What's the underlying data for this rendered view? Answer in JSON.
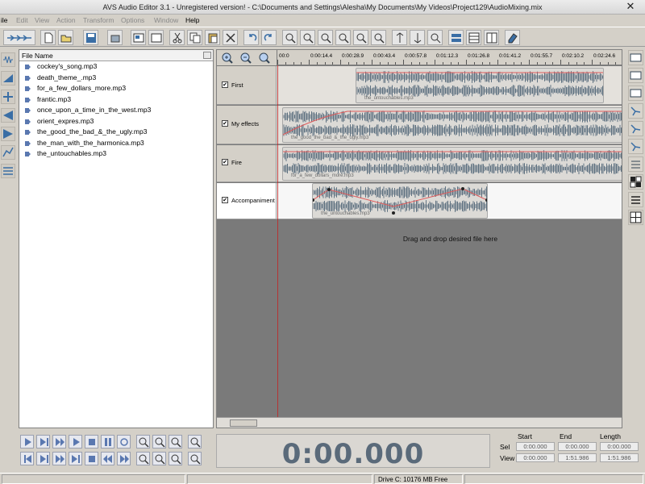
{
  "window": {
    "title": "AVS Audio Editor 3.1 - Unregistered version! - C:\\Documents and Settings\\Alesha\\My Documents\\My Videos\\Project129\\AudioMixing.mix",
    "close_glyph": "✕"
  },
  "menu": [
    "ile",
    "Edit",
    "View",
    "Action",
    "Transform",
    "Options",
    "Window",
    "Help"
  ],
  "file_list": {
    "header": "File Name",
    "files": [
      "cockey's_song.mp3",
      "death_theme_.mp3",
      "for_a_few_dollars_more.mp3",
      "frantic.mp3",
      "once_upon_a_time_in_the_west.mp3",
      "orient_expres.mp3",
      "the_good_the_bad_&_the_ugly.mp3",
      "the_man_with_the_harmonica.mp3",
      "the_untouchables.mp3"
    ]
  },
  "ruler": {
    "ticks": [
      "00:0",
      "0:00:14.4",
      "0:00:28.9",
      "0:00:43.4",
      "0:00:57.8",
      "0:01:12.3",
      "0:01:26.8",
      "0:01:41.2",
      "0:01:55.7",
      "0:02:10.2",
      "0:02:24.6"
    ]
  },
  "tracks": [
    {
      "name": "First",
      "checked": "✔",
      "clip": "the_untouchables.mp3"
    },
    {
      "name": "My effects",
      "checked": "✔",
      "clip": "the_good_the_bad_&_the_ugly.mp3"
    },
    {
      "name": "Fire",
      "checked": "✔",
      "clip": "for_a_few_dollars_more.mp3"
    },
    {
      "name": "Accompaniment",
      "checked": "✔",
      "clip": "the_untouchables.mp3"
    }
  ],
  "drop_hint": "Drag and drop desired file here",
  "time_display": "0:00.000",
  "selection": {
    "headers": [
      "Start",
      "End",
      "Length"
    ],
    "rows": [
      {
        "label": "Sel",
        "start": "0:00.000",
        "end": "0:00.000",
        "length": "0:00.000"
      },
      {
        "label": "View",
        "start": "0:00.000",
        "end": "1:51.986",
        "length": "1:51.986"
      }
    ]
  },
  "status": {
    "drive": "Drive C: 10176 MB Free"
  },
  "colors": {
    "accent": "#3a6ea5",
    "waveform": "#5f7281",
    "envelope": "#e05a5a",
    "mixer_bg": "#7a7a7a"
  }
}
